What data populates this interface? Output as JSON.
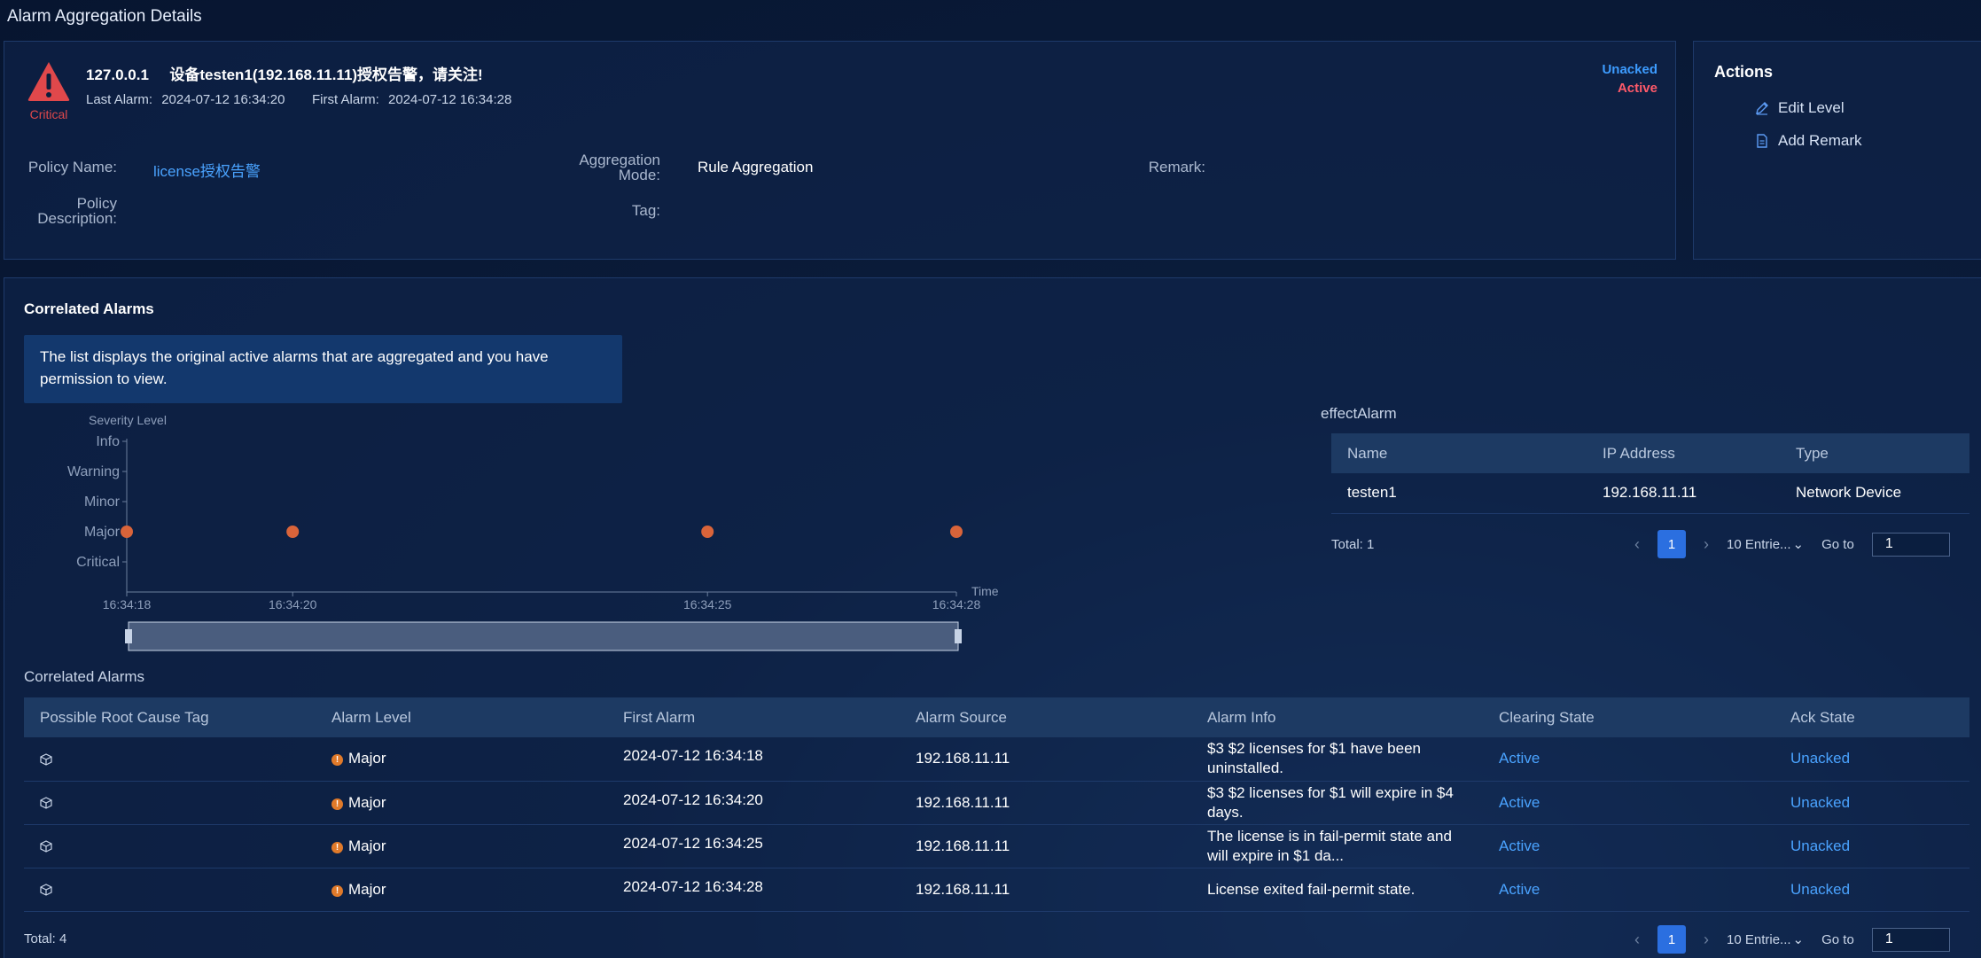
{
  "page_title": "Alarm Aggregation Details",
  "alarm": {
    "severity": "Critical",
    "ip": "127.0.0.1",
    "title": "设备testen1(192.168.11.11)授权告警，请关注!",
    "last_alarm_label": "Last Alarm:",
    "last_alarm_value": "2024-07-12 16:34:20",
    "first_alarm_label": "First Alarm:",
    "first_alarm_value": "2024-07-12 16:34:28",
    "ack_state": "Unacked",
    "clear_state": "Active",
    "ack_color": "#3d9cff",
    "clear_color": "#ff5a6a"
  },
  "details": {
    "policy_name_label": "Policy Name:",
    "policy_name_value": "license授权告警",
    "policy_desc_label_1": "Policy",
    "policy_desc_label_2": "Description:",
    "agg_mode_label_1": "Aggregation",
    "agg_mode_label_2": "Mode:",
    "agg_mode_value": "Rule Aggregation",
    "tag_label": "Tag:",
    "remark_label": "Remark:"
  },
  "actions": {
    "title": "Actions",
    "edit_level": "Edit Level",
    "add_remark": "Add Remark"
  },
  "correlated": {
    "title": "Correlated Alarms",
    "info_text": "The list displays the original active alarms that are aggregated and you have permission to view.",
    "table_title": "Correlated Alarms",
    "columns": [
      "Possible Root Cause Tag",
      "Alarm Level",
      "First Alarm",
      "Alarm Source",
      "Alarm Info",
      "Clearing State",
      "Ack State"
    ],
    "rows": [
      {
        "level": "Major",
        "first": "2024-07-12 16:34:18",
        "source": "192.168.11.11",
        "info": "$3 $2 licenses for $1 have been uninstalled.",
        "clearing": "Active",
        "ack": "Unacked"
      },
      {
        "level": "Major",
        "first": "2024-07-12 16:34:20",
        "source": "192.168.11.11",
        "info": "$3 $2 licenses for $1 will expire in $4 days.",
        "clearing": "Active",
        "ack": "Unacked"
      },
      {
        "level": "Major",
        "first": "2024-07-12 16:34:25",
        "source": "192.168.11.11",
        "info": "The license is in fail-permit state and will expire in $1 da...",
        "clearing": "Active",
        "ack": "Unacked"
      },
      {
        "level": "Major",
        "first": "2024-07-12 16:34:28",
        "source": "192.168.11.11",
        "info": "License exited fail-permit state.",
        "clearing": "Active",
        "ack": "Unacked"
      }
    ],
    "total": "Total: 4",
    "page": "1",
    "page_size": "10 Entrie...",
    "goto_label": "Go to",
    "goto_value": "1"
  },
  "effect": {
    "title": "effectAlarm",
    "columns": [
      "Name",
      "IP Address",
      "Type"
    ],
    "rows": [
      {
        "name": "testen1",
        "ip": "192.168.11.11",
        "type": "Network Device"
      }
    ],
    "total": "Total: 1",
    "page": "1",
    "page_size": "10 Entrie...",
    "goto_label": "Go to",
    "goto_value": "1"
  },
  "chart_data": {
    "type": "scatter",
    "ylabel": "Severity Level",
    "xlabel": "Time",
    "y_categories": [
      "Critical",
      "Major",
      "Minor",
      "Warning",
      "Info"
    ],
    "x_ticks": [
      "16:34:18",
      "16:34:20",
      "16:34:25",
      "16:34:28"
    ],
    "x_range_seconds": [
      18,
      28
    ],
    "points": [
      {
        "x": "16:34:18",
        "y": "Major"
      },
      {
        "x": "16:34:20",
        "y": "Major"
      },
      {
        "x": "16:34:25",
        "y": "Major"
      },
      {
        "x": "16:34:28",
        "y": "Major"
      }
    ],
    "point_color": "#d9643a",
    "grid": false
  }
}
